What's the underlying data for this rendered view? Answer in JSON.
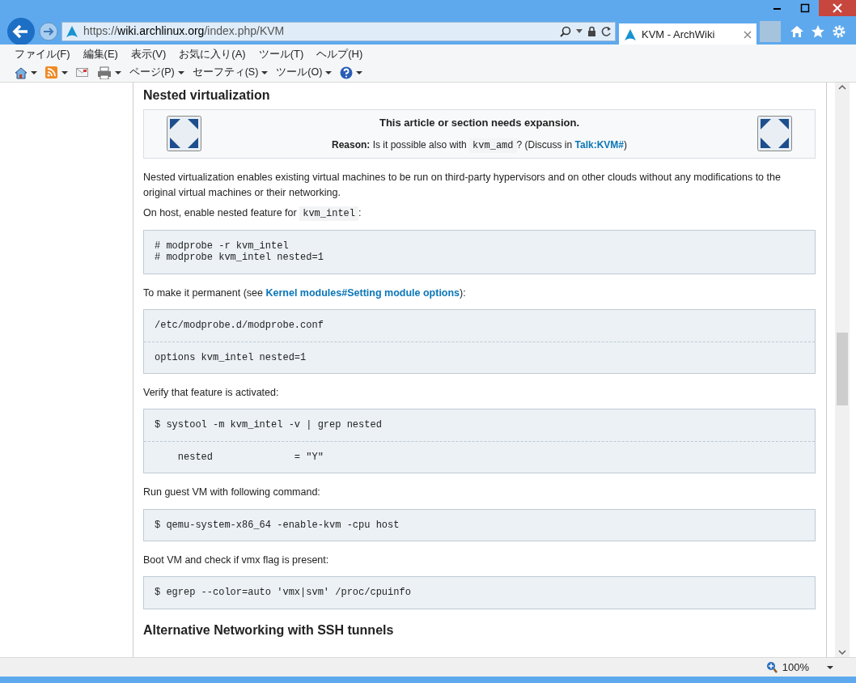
{
  "address_bar": {
    "scheme": "https://",
    "host": "wiki.archlinux.org",
    "path": "/index.php/KVM"
  },
  "tab": {
    "title": "KVM - ArchWiki",
    "selected": true
  },
  "menu": [
    "ファイル(F)",
    "編集(E)",
    "表示(V)",
    "お気に入り(A)",
    "ツール(T)",
    "ヘルプ(H)"
  ],
  "command_bar": [
    {
      "kind": "home"
    },
    {
      "kind": "feed"
    },
    {
      "kind": "mail"
    },
    {
      "kind": "print"
    },
    {
      "kind": "menu",
      "label": "ページ(P)"
    },
    {
      "kind": "menu",
      "label": "セーフティ(S)"
    },
    {
      "kind": "menu",
      "label": "ツール(O)"
    },
    {
      "kind": "help"
    }
  ],
  "article": [
    {
      "kind": "heading",
      "text": "Nested virtualization"
    },
    {
      "kind": "notice",
      "title": "This article or section needs expansion.",
      "reason_label": "Reason:",
      "parts": [
        {
          "kind": "text",
          "text": "Is it possible also with "
        },
        {
          "kind": "code",
          "text": "kvm_amd"
        },
        {
          "kind": "text",
          "text": "? (Discuss in "
        },
        {
          "kind": "link",
          "text": "Talk:KVM#"
        },
        {
          "kind": "text",
          "text": ")"
        }
      ]
    },
    {
      "kind": "paragraph",
      "parts": [
        {
          "kind": "text",
          "text": "Nested virtualization enables existing virtual machines to be run on third-party hypervisors and on other clouds without any modifications to the original virtual machines or their networking."
        }
      ]
    },
    {
      "kind": "paragraph",
      "parts": [
        {
          "kind": "text",
          "text": "On host, enable nested feature for "
        },
        {
          "kind": "code",
          "text": "kvm_intel"
        },
        {
          "kind": "text",
          "text": ":"
        }
      ]
    },
    {
      "kind": "code",
      "sections": [
        [
          "# modprobe -r kvm_intel",
          "# modprobe kvm_intel nested=1"
        ]
      ]
    },
    {
      "kind": "paragraph",
      "parts": [
        {
          "kind": "text",
          "text": "To make it permanent (see "
        },
        {
          "kind": "link",
          "text": "Kernel modules#Setting module options"
        },
        {
          "kind": "text",
          "text": "):"
        }
      ]
    },
    {
      "kind": "code",
      "sections": [
        [
          "/etc/modprobe.d/modprobe.conf"
        ],
        [
          "options kvm_intel nested=1"
        ]
      ]
    },
    {
      "kind": "paragraph",
      "parts": [
        {
          "kind": "text",
          "text": "Verify that feature is activated:"
        }
      ]
    },
    {
      "kind": "code",
      "sections": [
        [
          "$ systool -m kvm_intel -v | grep nested"
        ],
        [
          "    nested              = \"Y\""
        ]
      ]
    },
    {
      "kind": "paragraph",
      "parts": [
        {
          "kind": "text",
          "text": "Run guest VM with following command:"
        }
      ]
    },
    {
      "kind": "code",
      "sections": [
        [
          "$ qemu-system-x86_64 -enable-kvm -cpu host"
        ]
      ]
    },
    {
      "kind": "paragraph",
      "parts": [
        {
          "kind": "text",
          "text": "Boot VM and check if vmx flag is present:"
        }
      ]
    },
    {
      "kind": "code",
      "sections": [
        [
          "$ egrep --color=auto 'vmx|svm' /proc/cpuinfo"
        ]
      ]
    },
    {
      "kind": "heading",
      "text": "Alternative Networking with SSH tunnels"
    }
  ],
  "status_bar": {
    "zoom": "100%"
  }
}
